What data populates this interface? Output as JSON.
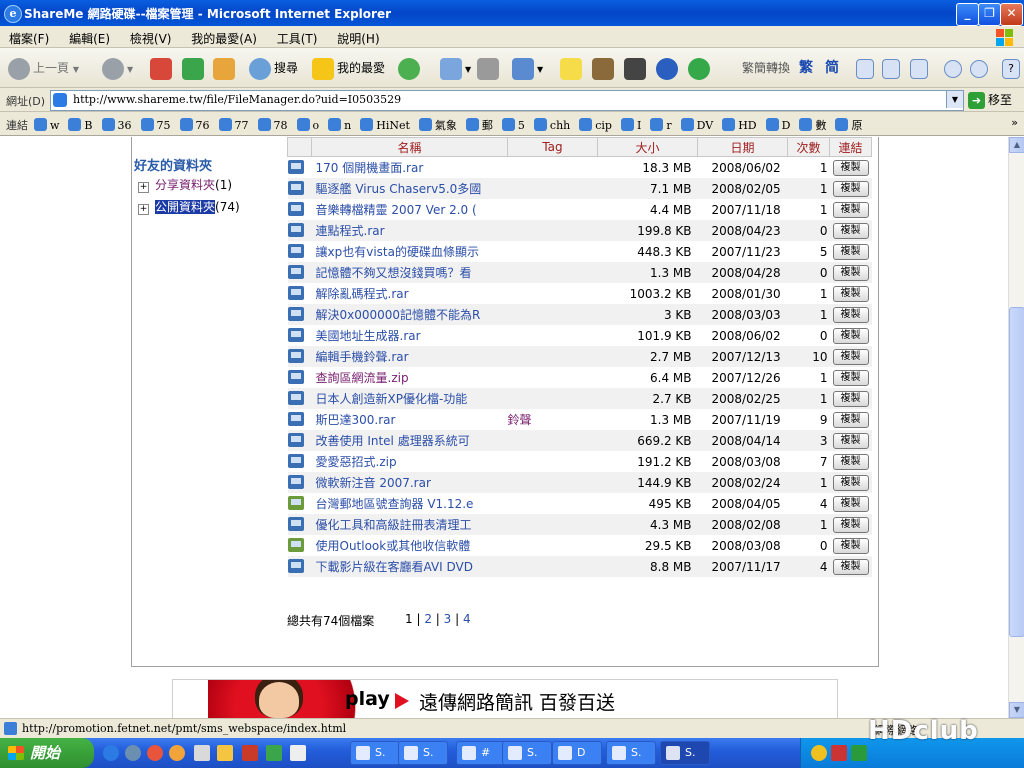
{
  "window": {
    "title": "ShareMe 網路硬碟--檔案管理 - Microsoft Internet Explorer"
  },
  "menu": [
    "檔案(F)",
    "編輯(E)",
    "檢視(V)",
    "我的最愛(A)",
    "工具(T)",
    "說明(H)"
  ],
  "toolbar": {
    "back_label": "上一頁",
    "search_label": "搜尋",
    "favorites_label": "我的最愛",
    "convert_label": "繁簡轉換",
    "trad_label": "繁",
    "simp_label": "简"
  },
  "address": {
    "label": "網址(D)",
    "url": "http://www.shareme.tw/file/FileManager.do?uid=I0503529",
    "go_label": "移至"
  },
  "links": {
    "label": "連結",
    "items": [
      "w",
      "B",
      "36",
      "75",
      "76",
      "77",
      "78",
      "o",
      "n",
      "HiNet",
      "氣象",
      "郵",
      "5",
      "chh",
      "cip",
      "I",
      "r",
      "DV",
      "HD",
      "D",
      "數",
      "原"
    ]
  },
  "sidebar": {
    "title": "好友的資料夾",
    "folders": [
      {
        "name": "分享資料夾",
        "count": "(1)"
      },
      {
        "name": "公開資料夾",
        "count": "(74)"
      }
    ]
  },
  "table": {
    "headers": [
      "名稱",
      "Tag",
      "大小",
      "日期",
      "次數",
      "連結"
    ],
    "copy_label": "複製",
    "rows": [
      {
        "name": "170 個開機畫面.rar",
        "tag": "",
        "size": "18.3 MB",
        "date": "2008/06/02",
        "count": "1"
      },
      {
        "name": "驅逐艦 Virus Chaserv5.0多國",
        "tag": "",
        "size": "7.1 MB",
        "date": "2008/02/05",
        "count": "1"
      },
      {
        "name": "音樂轉檔精靈 2007 Ver 2.0 (",
        "tag": "",
        "size": "4.4 MB",
        "date": "2007/11/18",
        "count": "1"
      },
      {
        "name": "連點程式.rar",
        "tag": "",
        "size": "199.8 KB",
        "date": "2008/04/23",
        "count": "0"
      },
      {
        "name": "讓xp也有vista的硬碟血條顯示",
        "tag": "",
        "size": "448.3 KB",
        "date": "2007/11/23",
        "count": "5"
      },
      {
        "name": "記憶體不夠又想沒錢買嗎？看",
        "tag": "",
        "size": "1.3 MB",
        "date": "2008/04/28",
        "count": "0"
      },
      {
        "name": "解除亂碼程式.rar",
        "tag": "",
        "size": "1003.2 KB",
        "date": "2008/01/30",
        "count": "1"
      },
      {
        "name": "解決0x000000記憶體不能為R",
        "tag": "",
        "size": "3 KB",
        "date": "2008/03/03",
        "count": "1"
      },
      {
        "name": "美國地址生成器.rar",
        "tag": "",
        "size": "101.9 KB",
        "date": "2008/06/02",
        "count": "0"
      },
      {
        "name": "編輯手機鈴聲.rar",
        "tag": "",
        "size": "2.7 MB",
        "date": "2007/12/13",
        "count": "10"
      },
      {
        "name": "查詢區網流量.zip",
        "tag": "",
        "size": "6.4 MB",
        "date": "2007/12/26",
        "count": "1"
      },
      {
        "name": "日本人創造新XP優化檔-功能",
        "tag": "",
        "size": "2.7 KB",
        "date": "2008/02/25",
        "count": "1"
      },
      {
        "name": "斯巴達300.rar",
        "tag": "鈴聲",
        "size": "1.3 MB",
        "date": "2007/11/19",
        "count": "9"
      },
      {
        "name": "改善使用 Intel 處理器系統可",
        "tag": "",
        "size": "669.2 KB",
        "date": "2008/04/14",
        "count": "3"
      },
      {
        "name": "愛愛惡招式.zip",
        "tag": "",
        "size": "191.2 KB",
        "date": "2008/03/08",
        "count": "7"
      },
      {
        "name": "微軟新注音 2007.rar",
        "tag": "",
        "size": "144.9 KB",
        "date": "2008/02/24",
        "count": "1"
      },
      {
        "name": "台灣郵地區號查詢器 V1.12.e",
        "tag": "",
        "size": "495 KB",
        "date": "2008/04/05",
        "count": "4"
      },
      {
        "name": "優化工具和高級註冊表清理工",
        "tag": "",
        "size": "4.3 MB",
        "date": "2008/02/08",
        "count": "1"
      },
      {
        "name": "使用Outlook或其他收信軟體",
        "tag": "",
        "size": "29.5 KB",
        "date": "2008/03/08",
        "count": "0"
      },
      {
        "name": "下載影片級在客廳看AVI DVD",
        "tag": "",
        "size": "8.8 MB",
        "date": "2007/11/17",
        "count": "4"
      }
    ]
  },
  "footer": {
    "total": "總共有74個檔案",
    "pages": [
      "1",
      "2",
      "3",
      "4"
    ]
  },
  "banner": {
    "play": "play",
    "text": "遠傳網路簡訊  百發百送"
  },
  "status": {
    "url": "http://promotion.fetnet.net/pmt/sms_webspace/index.html",
    "zone": "網際網路"
  },
  "taskbar": {
    "start_label": "開始",
    "tasks": [
      "S.",
      "S.",
      "#",
      "S.",
      "D",
      "S.",
      "S."
    ]
  },
  "watermark": "HDclub"
}
